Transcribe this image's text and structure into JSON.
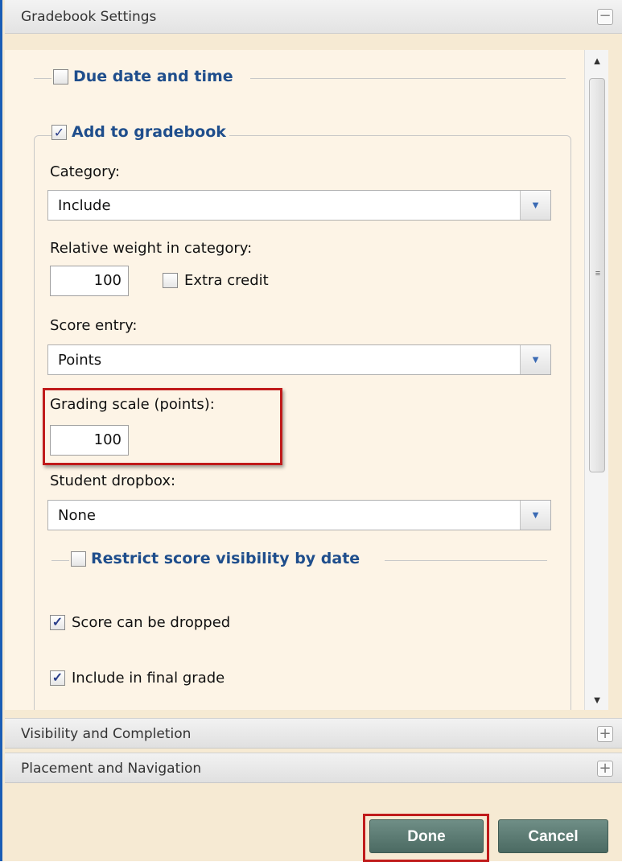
{
  "header": {
    "title": "Gradebook Settings",
    "collapse_symbol": "−"
  },
  "due_date": {
    "label": "Due date and time",
    "checked": false
  },
  "add_to_gradebook": {
    "label": "Add to gradebook",
    "checked": true,
    "check_glyph": "✓"
  },
  "category": {
    "label": "Category:",
    "value": "Include"
  },
  "relative_weight": {
    "label": "Relative weight in category:",
    "value": "100"
  },
  "extra_credit": {
    "label": "Extra credit",
    "checked": false
  },
  "score_entry": {
    "label": "Score entry:",
    "value": "Points"
  },
  "grading_scale": {
    "label": "Grading scale (points):",
    "value": "100"
  },
  "student_dropbox": {
    "label": "Student dropbox:",
    "value": "None"
  },
  "restrict_visibility": {
    "label": "Restrict score visibility by date",
    "checked": false
  },
  "score_dropped": {
    "label": "Score can be dropped",
    "checked": true
  },
  "include_final": {
    "label": "Include in final grade",
    "checked": true
  },
  "sections": [
    {
      "label": "Visibility and Completion",
      "expand_symbol": "+"
    },
    {
      "label": "Placement and Navigation",
      "expand_symbol": "+"
    }
  ],
  "buttons": {
    "done": "Done",
    "cancel": "Cancel"
  },
  "icons": {
    "dropdown": "chevron-down-icon",
    "scroll_up": "▲",
    "scroll_down": "▼",
    "grip": "≡",
    "dropdown_glyph": "▼"
  },
  "colors": {
    "accent_border": "#1a5db5",
    "highlight": "#c01b1b",
    "legend_text": "#1f4e8c",
    "button": "#5b7a72"
  }
}
